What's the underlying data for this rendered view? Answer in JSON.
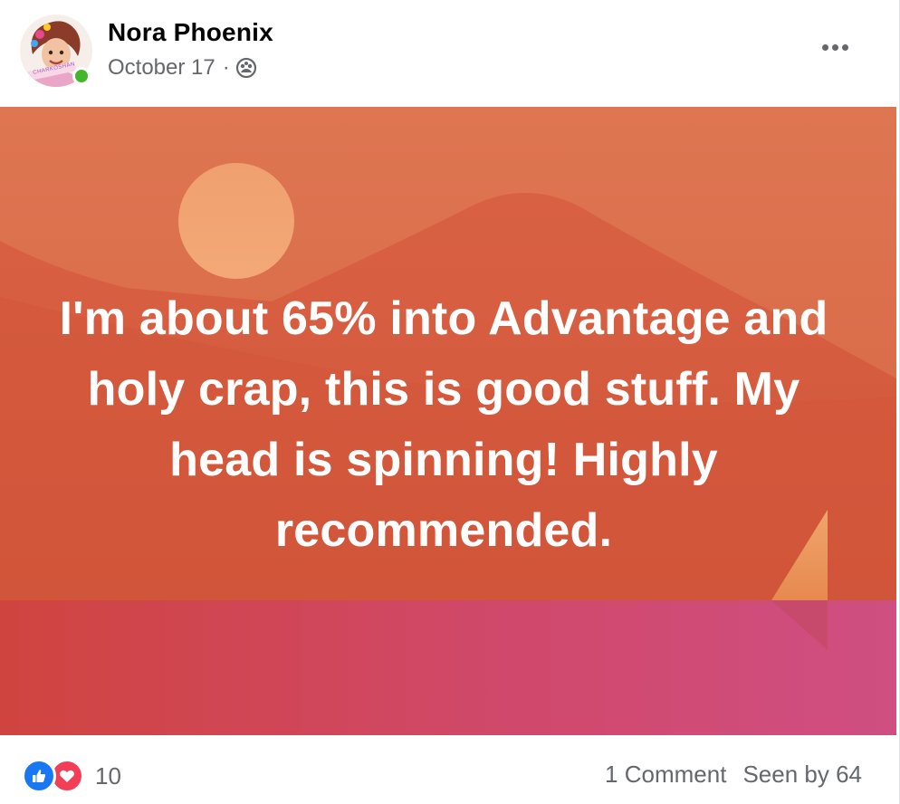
{
  "post": {
    "author": "Nora Phoenix",
    "date": "October 17",
    "separator": "·",
    "audience_icon": "friends-icon",
    "more_icon": "more-options-icon",
    "avatar_label": "CHARKOSHAN",
    "online": true,
    "text": "I'm about 65% into Advantage and holy crap, this is good stuff. My head is spinning! Highly recommended.",
    "background_colors": {
      "top": "#dc7250",
      "middle": "#d3583f",
      "bottom": "#cf4a6e",
      "sun": "#f2a473"
    }
  },
  "footer": {
    "reactions": [
      "like",
      "love"
    ],
    "reaction_count": "10",
    "comments": "1 Comment",
    "seen_by": "Seen by 64"
  },
  "colors": {
    "like": "#1877f2",
    "love": "#f33e58",
    "online": "#42b72a"
  }
}
